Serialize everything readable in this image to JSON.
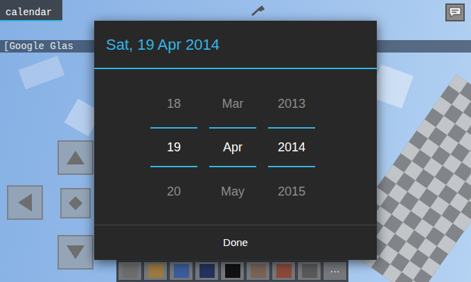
{
  "hud": {
    "tab_label": "calendar",
    "chat_line": "[Google Glas",
    "hotbar": [
      {
        "color": "#6e6e6e"
      },
      {
        "color": "#9c7a44"
      },
      {
        "color": "#3c5d9c"
      },
      {
        "color": "#24345e"
      },
      {
        "color": "#121212"
      },
      {
        "color": "#7a6458"
      },
      {
        "color": "#8c4a3a"
      },
      {
        "color": "#5a5a5a"
      }
    ],
    "more_label": "···"
  },
  "dialog": {
    "title": "Sat, 19 Apr 2014",
    "columns": [
      {
        "field": "day",
        "prev": "18",
        "value": "19",
        "next": "20"
      },
      {
        "field": "month",
        "prev": "Mar",
        "value": "Apr",
        "next": "May"
      },
      {
        "field": "year",
        "prev": "2013",
        "value": "2014",
        "next": "2015"
      }
    ],
    "done_label": "Done"
  }
}
